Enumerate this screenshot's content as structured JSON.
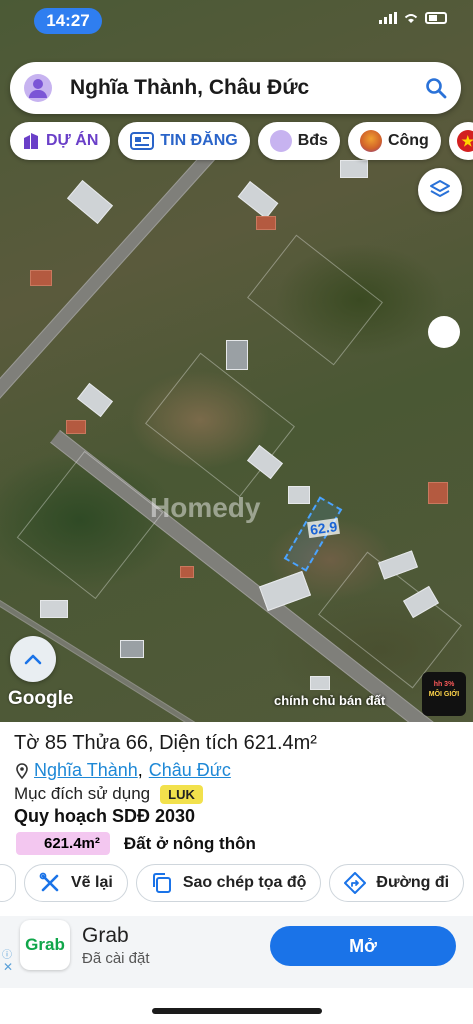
{
  "status_bar": {
    "time": "14:27"
  },
  "search": {
    "text": "Nghĩa Thành, Châu Đức"
  },
  "chips": [
    {
      "label": "DỰ ÁN"
    },
    {
      "label": "TIN ĐĂNG"
    },
    {
      "label": "Bđs"
    },
    {
      "label": "Công"
    }
  ],
  "map": {
    "plot_dimension": "62.9",
    "watermark": "Homedy",
    "google_label": "Google",
    "caption": "chính chủ bán đất",
    "broker_badge": {
      "percent": "hh 3%",
      "label": "MÔI GIỚI"
    }
  },
  "panel": {
    "title": "Tờ 85 Thửa 66, Diện tích 621.4m²",
    "location": {
      "ward": "Nghĩa Thành",
      "separator": ",",
      "district": "Châu Đức"
    },
    "purpose_label": "Mục đích sử dụng",
    "purpose_code": "LUK",
    "plan_title": "Quy hoạch SDĐ 2030",
    "plan_area": "621.4m²",
    "plan_type": "Đất ở nông thôn",
    "actions": {
      "reset": "Vẽ lại",
      "copy_coords": "Sao chép tọa độ",
      "directions": "Đường đi"
    }
  },
  "ad": {
    "logo_text": "Grab",
    "title": "Grab",
    "subtitle": "Đã cài đặt",
    "button": "Mở",
    "close": "✕"
  }
}
